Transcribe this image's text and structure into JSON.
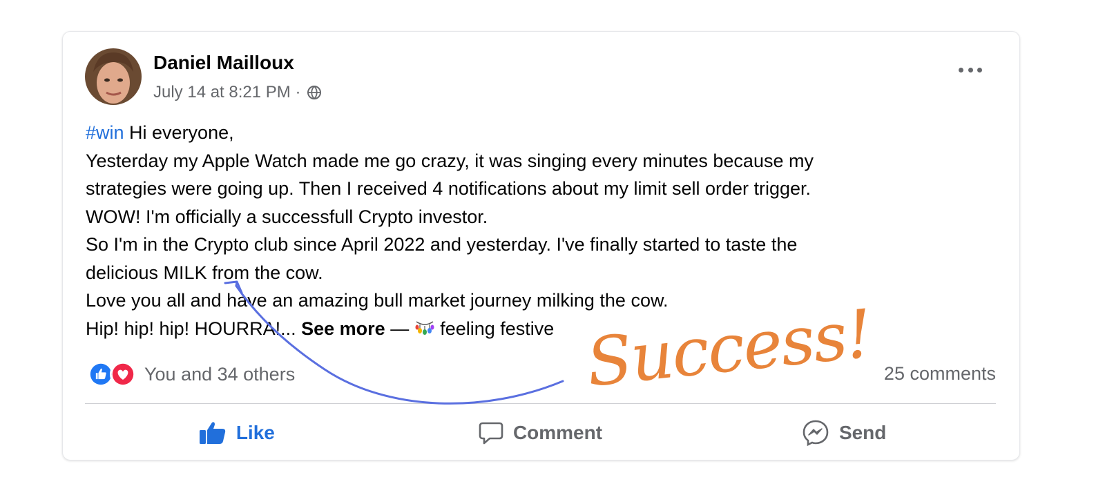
{
  "post": {
    "author": "Daniel Mailloux",
    "timestamp": "July 14 at 8:21 PM ·",
    "privacy_icon": "globe-icon",
    "body": {
      "hashtag": "#win",
      "line1_rest": " Hi everyone,",
      "line2": "Yesterday my Apple Watch made me go crazy, it was singing every minutes because my",
      "line3": "strategies were going up. Then I received 4 notifications about my limit sell order trigger.",
      "line4": "WOW! I'm officially a successfull Crypto investor.",
      "line5": "So I'm in the Crypto club since April 2022 and yesterday. I've finally started to taste the",
      "line6": "delicious MILK from the cow.",
      "line7": "Love you all and have an amazing bull market journey milking the cow.",
      "line8": "Hip! hip! hip! HOURRA!...",
      "see_more": "See more",
      "feeling_dash": " — ",
      "feeling": "feeling festive"
    },
    "reactions": {
      "icons": [
        "like-reaction-icon",
        "love-reaction-icon"
      ],
      "summary": "You and 34 others"
    },
    "comments_count": "25 comments",
    "actions": {
      "like": "Like",
      "comment": "Comment",
      "send": "Send"
    }
  },
  "annotation": {
    "text": "Success!",
    "color": "#e8843a",
    "arrow_color": "#5a6fe0"
  },
  "colors": {
    "link_blue": "#216fdb",
    "secondary_text": "#65676b",
    "love_red": "#f02849"
  }
}
